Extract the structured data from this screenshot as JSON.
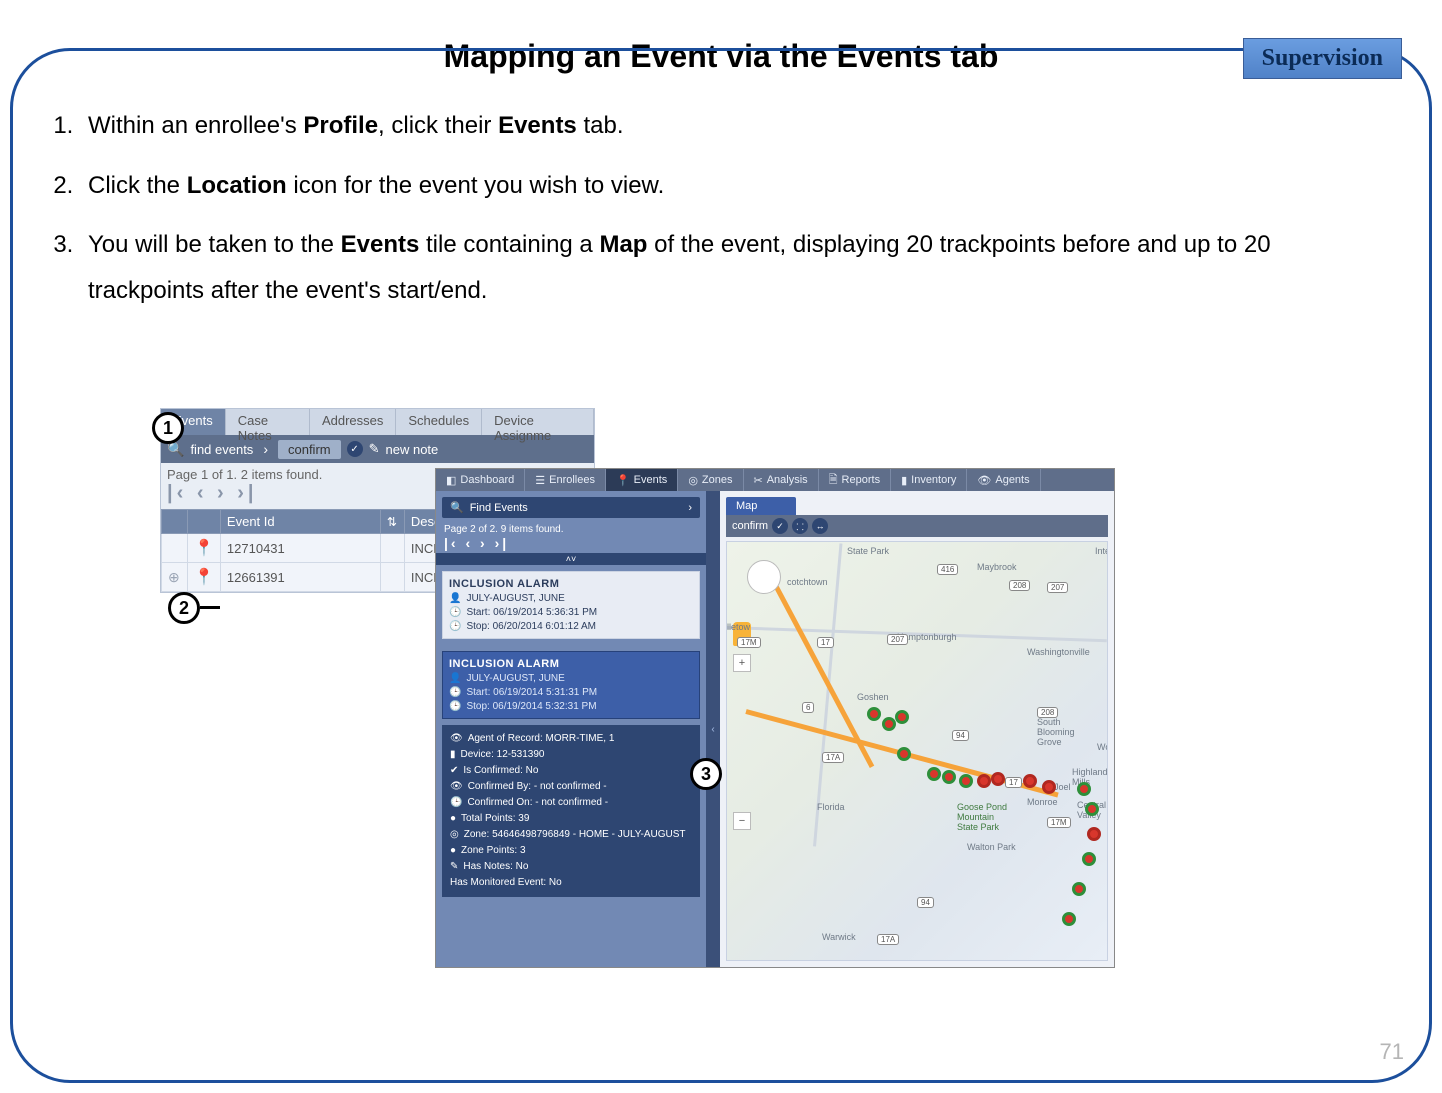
{
  "badge": "Supervision",
  "title": "Mapping an Event via the Events tab",
  "steps": {
    "s1a": "Within an enrollee's ",
    "s1b": "Profile",
    "s1c": ", click their ",
    "s1d": "Events",
    "s1e": " tab.",
    "s2a": "Click the ",
    "s2b": "Location",
    "s2c": " icon for the event you wish to view.",
    "s3a": "You will be taken to the ",
    "s3b": "Events",
    "s3c": " tile containing a ",
    "s3d": "Map",
    "s3e": " of the event, displaying 20 trackpoints before and up to 20 trackpoints after the event's start/end."
  },
  "page_number": "71",
  "callouts": {
    "c1": "1",
    "c2": "2",
    "c3": "3"
  },
  "shot1": {
    "tabs": [
      "Events",
      "Case Notes",
      "Addresses",
      "Schedules",
      "Device Assignme"
    ],
    "find_label": "find events",
    "confirm_label": "confirm",
    "newnote_label": "new note",
    "page_status": "Page 1 of 1. 2 items found.",
    "pager_glyphs": "|‹ ‹ › ›|",
    "cols": {
      "eventid": "Event Id",
      "descr": "Descri"
    },
    "rows": [
      {
        "id": "12710431",
        "descr": "INCLUSION"
      },
      {
        "id": "12661391",
        "descr": "INCLUSION"
      }
    ]
  },
  "shot2": {
    "toptabs": [
      "Dashboard",
      "Enrollees",
      "Events",
      "Zones",
      "Analysis",
      "Reports",
      "Inventory",
      "Agents"
    ],
    "find_label": "Find Events",
    "page_status": "Page 2 of 2. 9 items found.",
    "pager_glyphs": "|‹ ‹ › ›|",
    "divider_hint": "˄˅",
    "card1": {
      "title": "INCLUSION ALARM",
      "enrollee": "JULY-AUGUST, JUNE",
      "start": "Start: 06/19/2014 5:36:31 PM",
      "stop": "Stop: 06/20/2014 6:01:12 AM"
    },
    "card2": {
      "title": "INCLUSION ALARM",
      "enrollee": "JULY-AUGUST, JUNE",
      "start": "Start: 06/19/2014 5:31:31 PM",
      "stop": "Stop: 06/19/2014 5:32:31 PM"
    },
    "details": {
      "agent": "Agent of Record: MORR-TIME, 1",
      "device": "Device: 12-531390",
      "confirmed": "Is Confirmed: No",
      "confirmed_by": "Confirmed By: - not confirmed -",
      "confirmed_on": "Confirmed On: - not confirmed -",
      "total_points": "Total Points: 39",
      "zone": "Zone: 54646498796849 - HOME - JULY-AUGUST",
      "zone_points": "Zone Points: 3",
      "has_notes": "Has Notes: No",
      "has_monitored": "Has Monitored Event: No"
    },
    "map_tab": "Map",
    "confirm_label": "confirm",
    "map_labels": {
      "statepark": "State Park",
      "maybrook": "Maybrook",
      "hamptonburgh": "Hamptonburgh",
      "washingtonville": "Washingtonville",
      "goshen": "Goshen",
      "southblooming": "South\nBlooming\nGrove",
      "florida": "Florida",
      "goosepond": "Goose Pond\nMountain\nState Park",
      "waltonpark": "Walton Park",
      "highland": "Highland\nMills",
      "central": "Central\nValley",
      "warwick": "Warwick",
      "monroe": "Monroe",
      "cotchtown": "cotchtown",
      "lletow": "lletow",
      "joel": "s Joel",
      "inter": "Inter",
      "woo": "Woo"
    },
    "shields": [
      "416",
      "208",
      "207",
      "17M",
      "17",
      "207",
      "6",
      "94",
      "17A",
      "208",
      "17",
      "17M",
      "94",
      "17A"
    ]
  }
}
